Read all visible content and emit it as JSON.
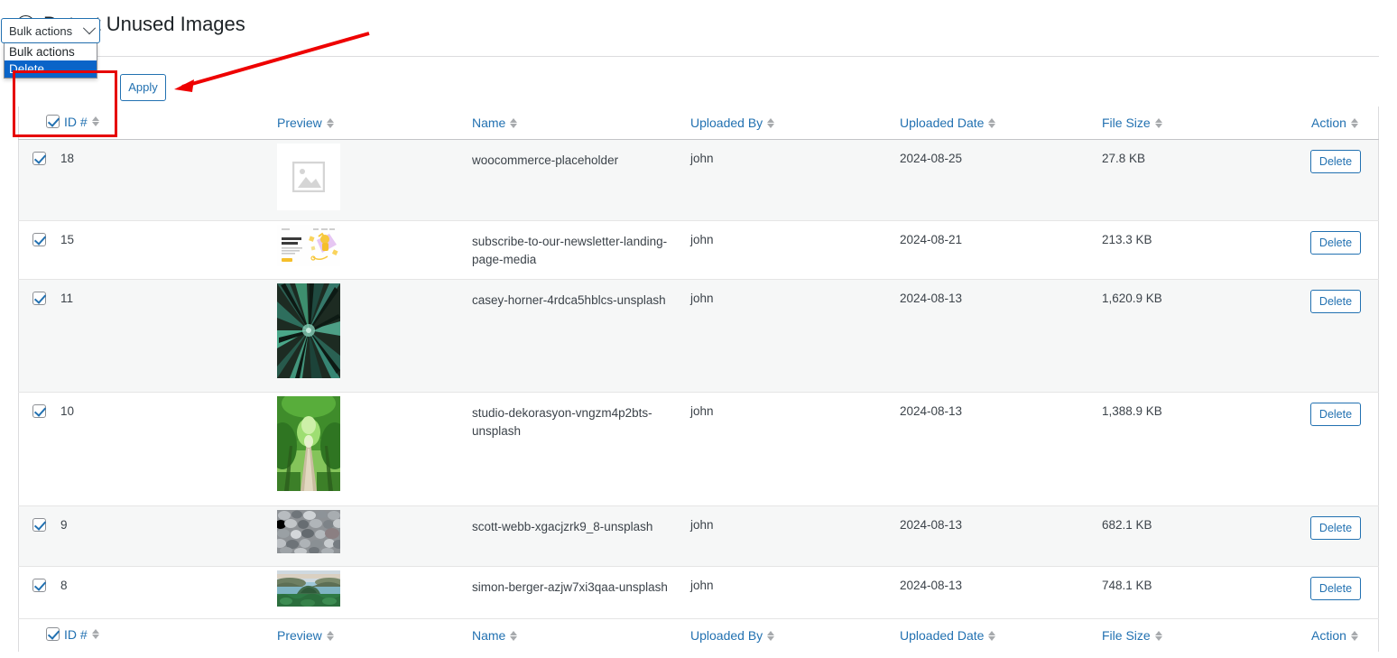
{
  "page": {
    "title": "Detect Unused Images",
    "collapse_icon": "minus-circle-icon"
  },
  "toolbar": {
    "bulk_select_value": "Bulk actions",
    "bulk_options": [
      "Bulk actions",
      "Delete"
    ],
    "bulk_selected_option": "Delete",
    "apply_label": "Apply",
    "chevron_icon": "chevron-down-icon"
  },
  "annotation": {
    "arrow_color": "#ee0000",
    "highlight_color": "#e60000"
  },
  "table": {
    "columns": [
      {
        "key": "id",
        "label": "ID #",
        "sortable": true
      },
      {
        "key": "preview",
        "label": "Preview",
        "sortable": true
      },
      {
        "key": "name",
        "label": "Name",
        "sortable": true
      },
      {
        "key": "uploaded_by",
        "label": "Uploaded By",
        "sortable": true
      },
      {
        "key": "uploaded_date",
        "label": "Uploaded Date",
        "sortable": true
      },
      {
        "key": "file_size",
        "label": "File Size",
        "sortable": true
      },
      {
        "key": "action",
        "label": "Action",
        "sortable": true
      }
    ],
    "action_label": "Delete",
    "rows": [
      {
        "id": "18",
        "checked": true,
        "preview_kind": "placeholder",
        "name": "woocommerce-placeholder",
        "uploaded_by": "john",
        "uploaded_date": "2024-08-25",
        "file_size": "27.8 KB",
        "action": "Delete"
      },
      {
        "id": "15",
        "checked": true,
        "preview_kind": "newsletter",
        "name": "subscribe-to-our-newsletter-landing-page-media",
        "uploaded_by": "john",
        "uploaded_date": "2024-08-21",
        "file_size": "213.3 KB",
        "action": "Delete"
      },
      {
        "id": "11",
        "checked": true,
        "preview_kind": "forest-canopy",
        "name": "casey-horner-4rdca5hblcs-unsplash",
        "uploaded_by": "john",
        "uploaded_date": "2024-08-13",
        "file_size": "1,620.9 KB",
        "action": "Delete"
      },
      {
        "id": "10",
        "checked": true,
        "preview_kind": "tree-road",
        "name": "studio-dekorasyon-vngzm4p2bts-unsplash",
        "uploaded_by": "john",
        "uploaded_date": "2024-08-13",
        "file_size": "1,388.9 KB",
        "action": "Delete"
      },
      {
        "id": "9",
        "checked": true,
        "preview_kind": "pebbles",
        "name": "scott-webb-xgacjzrk9_8-unsplash",
        "uploaded_by": "john",
        "uploaded_date": "2024-08-13",
        "file_size": "682.1 KB",
        "action": "Delete"
      },
      {
        "id": "8",
        "checked": true,
        "preview_kind": "coast",
        "name": "simon-berger-azjw7xi3qaa-unsplash",
        "uploaded_by": "john",
        "uploaded_date": "2024-08-13",
        "file_size": "748.1 KB",
        "action": "Delete"
      }
    ]
  }
}
